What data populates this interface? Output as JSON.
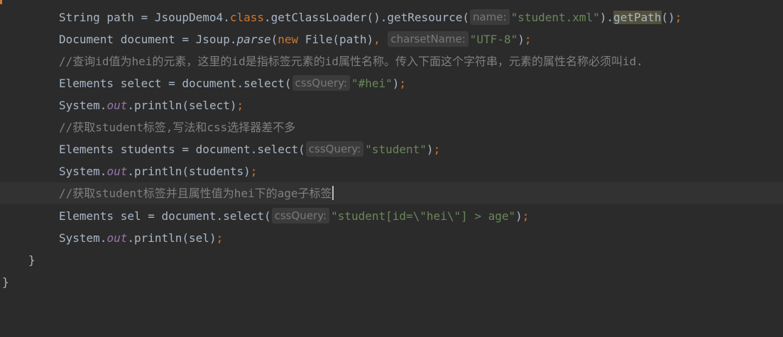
{
  "lines": {
    "l1": {
      "a": "String path = JsoupDemo4.",
      "b": "class",
      "c": ".getClassLoader().getResource(",
      "hint": "name:",
      "d": "\"student.xml\"",
      "e": ").",
      "f": "getPath",
      "g": "()",
      "h": ";"
    },
    "l2": {
      "a": "Document document = Jsoup.",
      "b": "parse",
      "c": "(",
      "d": "new",
      "e": " File(path)",
      "f": ",",
      "hint": "charsetName:",
      "g": "\"UTF-8\"",
      "h": ")",
      "i": ";"
    },
    "l3": {
      "comment": "//查询id值为hei的元素，这里的id是指标签元素的id属性名称。传入下面这个字符串，元素的属性名称必须叫id."
    },
    "l4": {
      "a": "Elements select = document.select(",
      "hint": "cssQuery:",
      "b": "\"#hei\"",
      "c": ")",
      "d": ";"
    },
    "l5": {
      "a": "System.",
      "b": "out",
      "c": ".println(select)",
      "d": ";"
    },
    "l6": {
      "comment": "//获取student标签,写法和css选择器差不多"
    },
    "l7": {
      "a": "Elements students = document.select(",
      "hint": "cssQuery:",
      "b": "\"student\"",
      "c": ")",
      "d": ";"
    },
    "l8": {
      "a": "System.",
      "b": "out",
      "c": ".println(students)",
      "d": ";"
    },
    "l9": {
      "comment": "//获取student标签并且属性值为hei下的age子标签"
    },
    "l10": {
      "a": "Elements sel = document.select(",
      "hint": "cssQuery:",
      "b": "\"student[id=\\\"hei\\\"] > age\"",
      "c": ")",
      "d": ";"
    },
    "l11": {
      "a": "System.",
      "b": "out",
      "c": ".println(sel)",
      "d": ";"
    },
    "l12": {
      "brace": "}"
    },
    "l13": {
      "brace": "}"
    }
  }
}
